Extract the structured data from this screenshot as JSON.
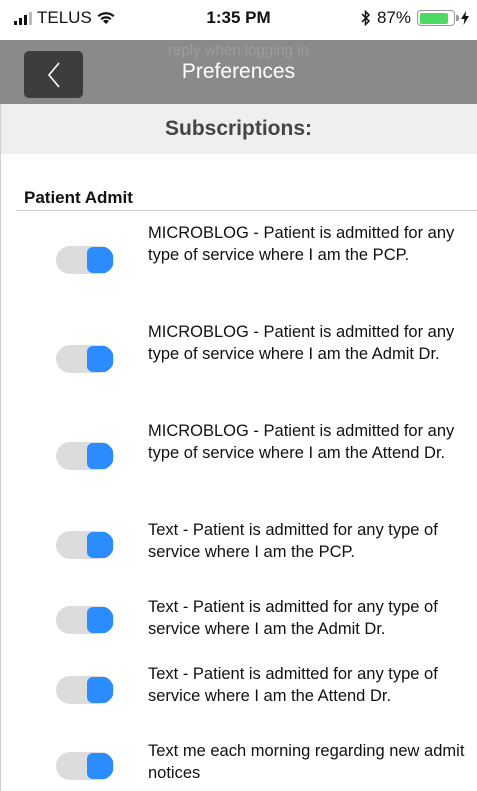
{
  "status_bar": {
    "carrier": "TELUS",
    "time": "1:35 PM",
    "bluetooth_icon": "bluetooth-icon",
    "battery_percent": "87%",
    "battery_level": 0.87
  },
  "nav": {
    "ghost_text": "reply when logging in",
    "title": "Preferences",
    "back_icon": "chevron-left-icon"
  },
  "section": {
    "title": "Subscriptions:"
  },
  "group": {
    "label": "Patient Admit",
    "items": [
      {
        "text": "MICROBLOG - Patient is admitted for any type of service where I am the PCP.",
        "enabled": true
      },
      {
        "text": "MICROBLOG - Patient is admitted for any type of service where I am the Admit Dr.",
        "enabled": true
      },
      {
        "text": "MICROBLOG - Patient is admitted for any type of service where I am the Attend Dr.",
        "enabled": true
      },
      {
        "text": "Text - Patient is admitted for any type of service where I am the PCP.",
        "enabled": true
      },
      {
        "text": "Text - Patient is admitted for any type of service where I am the Admit Dr.",
        "enabled": true
      },
      {
        "text": "Text - Patient is admitted for any type of service where I am the Attend Dr.",
        "enabled": true
      },
      {
        "text": "Text me each morning regarding new admit notices",
        "enabled": true
      }
    ]
  }
}
